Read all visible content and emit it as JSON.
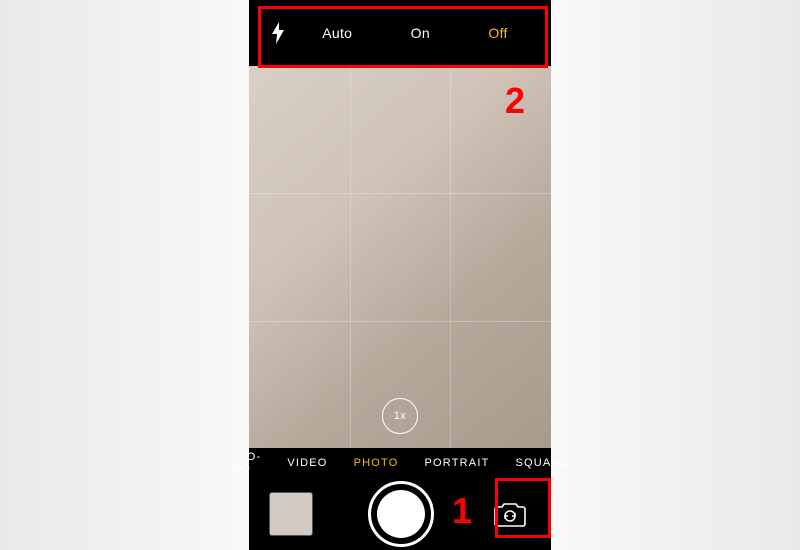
{
  "flash": {
    "options": [
      "Auto",
      "On",
      "Off"
    ],
    "selected": "Off"
  },
  "zoom": "1x",
  "modes": {
    "items": [
      "SLO-MO",
      "VIDEO",
      "PHOTO",
      "PORTRAIT",
      "SQUARE"
    ],
    "selected": "PHOTO"
  },
  "annotations": {
    "top": "2",
    "bottom": "1"
  }
}
